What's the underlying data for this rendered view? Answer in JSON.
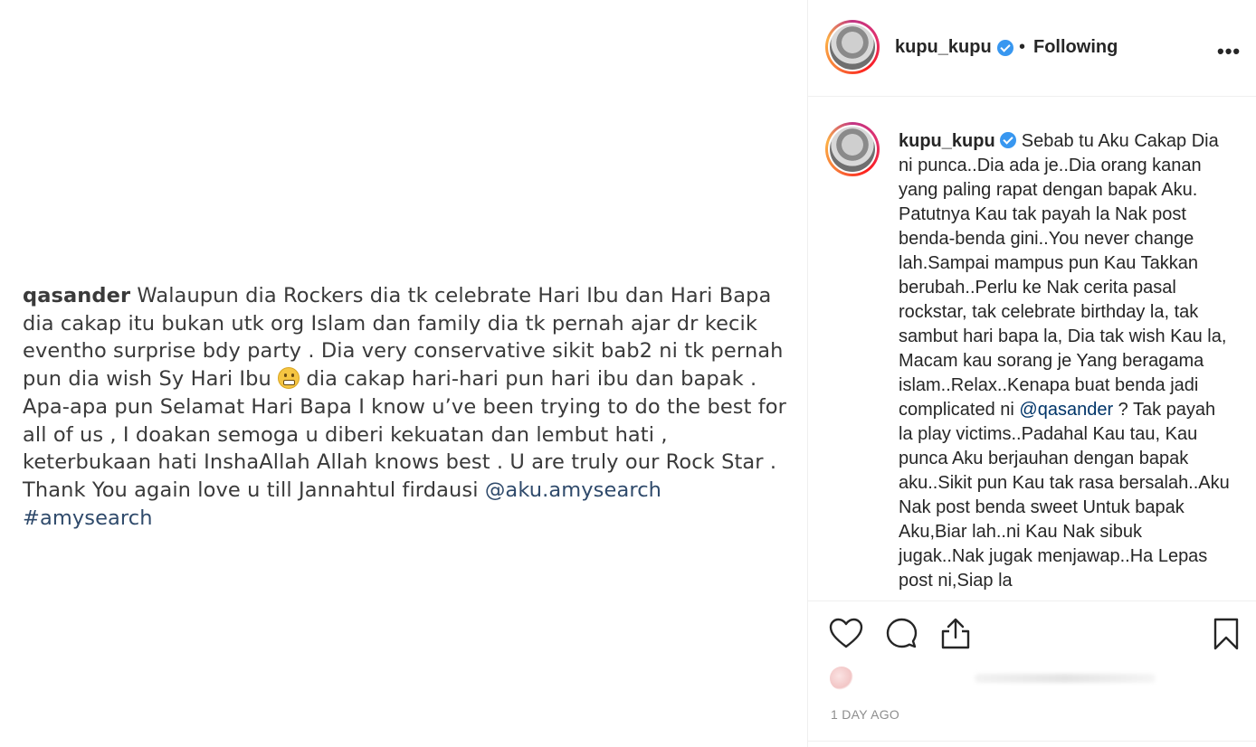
{
  "image_caption": {
    "username": "qasander",
    "text_part1": " Walaupun dia Rockers dia tk celebrate Hari Ibu dan Hari Bapa dia cakap itu bukan utk org Islam dan family dia tk pernah ajar dr kecik eventho surprise bdy party . Dia very conservative sikit bab2 ni tk pernah pun dia wish Sy Hari Ibu ",
    "emoji": "grimacing-face",
    "text_part2": " dia cakap hari-hari pun hari ibu dan bapak . Apa-apa pun Selamat Hari Bapa I know u’ve been trying to do the best for all of us , I doakan semoga u diberi kekuatan dan lembut hati ,  keterbukaan hati InshaAllah Allah knows best . U are truly our Rock Star . Thank You again love u till Jannahtul firdausi ",
    "mention": "@aku.amysearch",
    "hashtag": "#amysearch"
  },
  "header": {
    "username": "kupu_kupu",
    "separator": "•",
    "follow_status": "Following",
    "more_label": "•••"
  },
  "caption": {
    "username": "kupu_kupu",
    "text_part1": " Sebab tu Aku Cakap Dia ni punca..Dia ada je..Dia orang kanan yang paling rapat dengan bapak Aku. Patutnya Kau tak payah la Nak post benda-benda gini..You never change lah.Sampai mampus pun Kau Takkan berubah..Perlu ke Nak cerita pasal rockstar, tak celebrate birthday la, tak sambut hari bapa la, Dia tak wish Kau la, Macam kau sorang je Yang beragama islam..Relax..Kenapa buat benda jadi complicated ni ",
    "mention": "@qasander",
    "text_part2": " ? Tak payah la play victims..Padahal Kau tau, Kau punca Aku berjauhan dengan bapak aku..Sikit pun Kau tak rasa bersalah..Aku Nak post benda sweet Untuk bapak Aku,Biar lah..ni Kau Nak sibuk jugak..Nak jugak menjawap..Ha Lepas post ni,Siap la"
  },
  "actions": {
    "timestamp": "1 DAY AGO",
    "icons": [
      "heart-icon",
      "comment-icon",
      "share-icon",
      "bookmark-icon"
    ]
  },
  "colors": {
    "link": "#003569",
    "image_link": "#2f4a6b",
    "verified": "#3897f0",
    "muted": "#8e8e8e"
  }
}
